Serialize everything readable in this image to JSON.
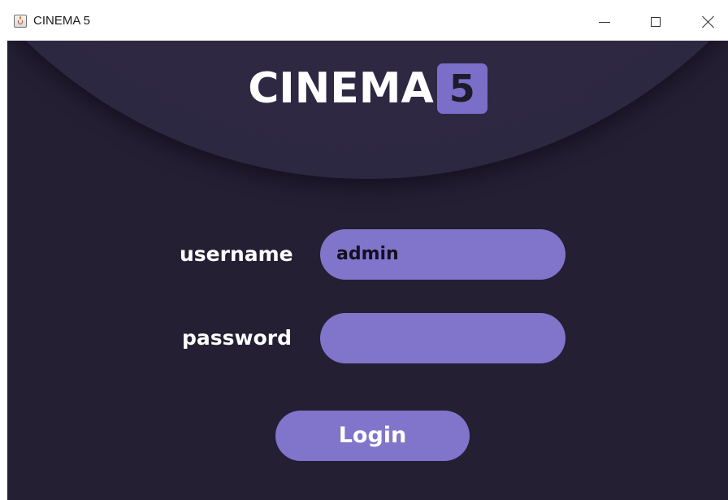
{
  "window": {
    "title": "CINEMA 5",
    "icon": "java-cup-icon",
    "controls": {
      "minimize": "minimize-icon",
      "maximize": "maximize-icon",
      "close": "close-icon"
    }
  },
  "logo": {
    "text": "CINEMA",
    "badge": "5"
  },
  "form": {
    "username_label": "username",
    "username_value": "admin",
    "password_label": "password",
    "password_value": "",
    "login_label": "Login"
  },
  "colors": {
    "background": "#241f33",
    "header_arc": "#2e2843",
    "accent": "#8075cb",
    "text": "#ffffff"
  }
}
